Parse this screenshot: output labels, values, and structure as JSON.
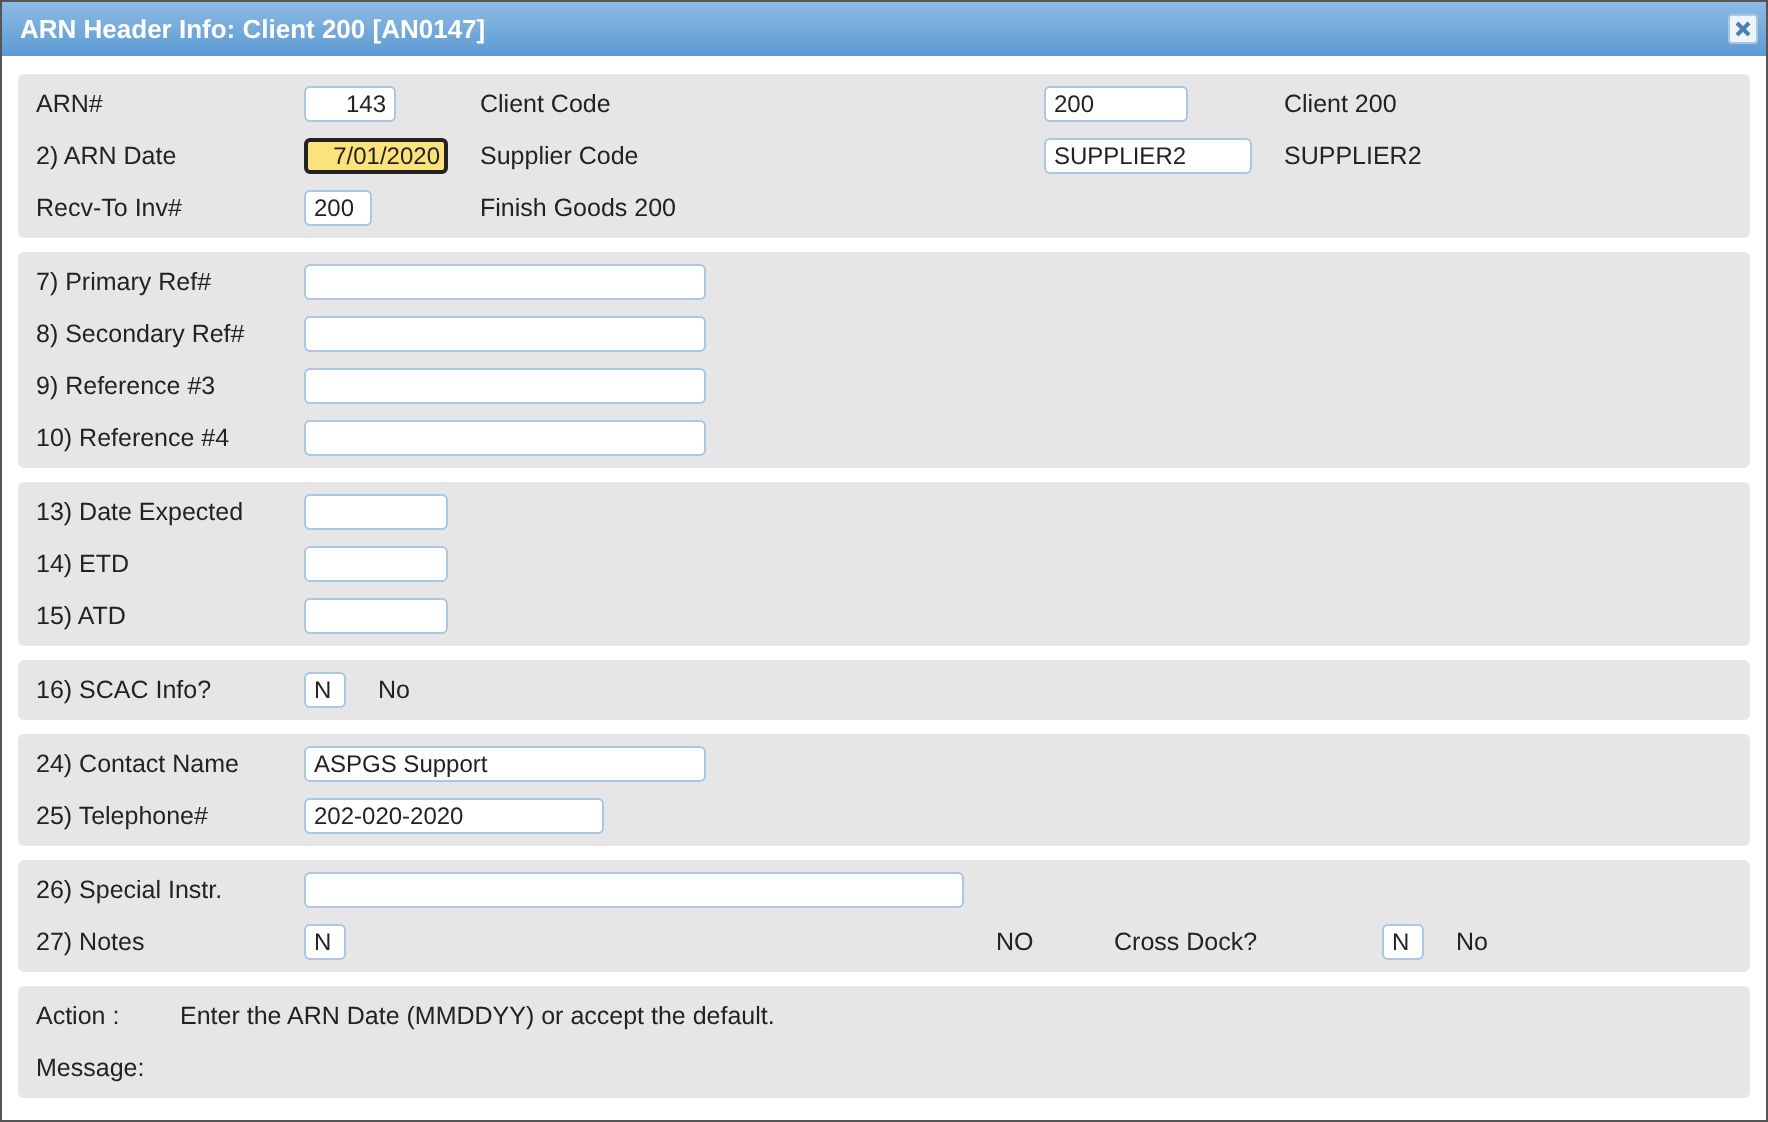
{
  "window": {
    "title": "ARN Header Info: Client 200 [AN0147]"
  },
  "sections": [
    {
      "rows": [
        [
          {
            "kind": "label",
            "text": "ARN#"
          },
          {
            "kind": "field",
            "value": "143",
            "focused": false
          },
          {
            "kind": "label",
            "text": "Client Code"
          },
          {
            "kind": "field",
            "value": "200",
            "focused": false
          },
          {
            "kind": "text",
            "text": "Client 200"
          }
        ],
        [
          {
            "kind": "label",
            "text": "2) ARN Date"
          },
          {
            "kind": "field",
            "value": "7/01/2020",
            "focused": true
          },
          {
            "kind": "label",
            "text": "Supplier Code"
          },
          {
            "kind": "field",
            "value": "SUPPLIER2",
            "focused": false
          },
          {
            "kind": "text",
            "text": "SUPPLIER2"
          }
        ],
        [
          {
            "kind": "label",
            "text": "Recv-To Inv#"
          },
          {
            "kind": "field",
            "value": "200",
            "focused": false
          },
          {
            "kind": "text",
            "text": "Finish Goods 200"
          }
        ]
      ]
    },
    {
      "rows": [
        [
          {
            "kind": "label",
            "text": "7) Primary Ref#"
          },
          {
            "kind": "field",
            "focused": false
          }
        ],
        [
          {
            "kind": "label",
            "text": "8) Secondary Ref#"
          },
          {
            "kind": "field",
            "focused": false
          }
        ],
        [
          {
            "kind": "label",
            "text": "9) Reference #3"
          },
          {
            "kind": "field",
            "focused": false
          }
        ],
        [
          {
            "kind": "label",
            "text": "10) Reference #4"
          },
          {
            "kind": "field",
            "focused": false
          }
        ]
      ]
    },
    {
      "rows": [
        [
          {
            "kind": "label",
            "text": "13) Date Expected"
          },
          {
            "kind": "field",
            "focused": false
          }
        ],
        [
          {
            "kind": "label",
            "text": "14) ETD"
          },
          {
            "kind": "field",
            "focused": false
          }
        ],
        [
          {
            "kind": "label",
            "text": "15) ATD"
          },
          {
            "kind": "field",
            "focused": false
          }
        ]
      ]
    },
    {
      "rows": [
        [
          {
            "kind": "label",
            "text": "16) SCAC Info?"
          },
          {
            "kind": "field",
            "value": "N",
            "focused": false
          },
          {
            "kind": "text",
            "text": "No"
          }
        ]
      ]
    },
    {
      "rows": [
        [
          {
            "kind": "label",
            "text": "24) Contact Name"
          },
          {
            "kind": "field",
            "value": "ASPGS Support",
            "focused": false
          }
        ],
        [
          {
            "kind": "label",
            "text": "25) Telephone#"
          },
          {
            "kind": "field",
            "value": "202-020-2020",
            "focused": false
          }
        ]
      ]
    },
    {
      "rows": [
        [
          {
            "kind": "label",
            "text": "26) Special Instr."
          },
          {
            "kind": "field",
            "focused": false
          }
        ],
        [
          {
            "kind": "label",
            "text": "27) Notes"
          },
          {
            "kind": "field",
            "value": "N",
            "focused": false
          },
          {
            "kind": "text",
            "text": "NO"
          },
          {
            "kind": "label",
            "text": "Cross Dock?"
          },
          {
            "kind": "field",
            "value": "N",
            "focused": false
          },
          {
            "kind": "text",
            "text": "No"
          }
        ]
      ]
    },
    {
      "rows": [
        [
          {
            "kind": "label",
            "text": "Action :"
          },
          {
            "kind": "text",
            "text": "Enter the ARN Date (MMDDYY) or accept the default."
          }
        ],
        [
          {
            "kind": "label",
            "text": "Message:"
          }
        ]
      ]
    }
  ]
}
